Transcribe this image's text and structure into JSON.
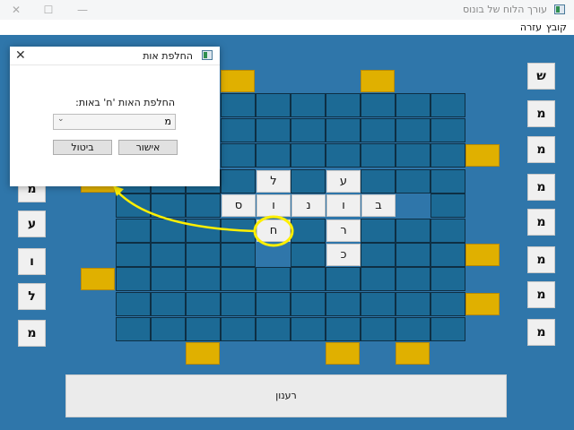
{
  "window": {
    "title": "עורך הלוח של בונוס",
    "minimize": "—",
    "maximize": "☐",
    "close": "✕"
  },
  "menu": [
    "קובץ",
    "עזרה"
  ],
  "board": {
    "empty_cells": [
      [
        104,
        3
      ],
      [
        104,
        4
      ],
      [
        104,
        5
      ],
      [
        104,
        6
      ],
      [
        104,
        7
      ],
      [
        104,
        8
      ],
      [
        104,
        9
      ],
      [
        132,
        3
      ],
      [
        132,
        4
      ],
      [
        132,
        5
      ],
      [
        132,
        6
      ],
      [
        132,
        7
      ],
      [
        132,
        8
      ],
      [
        132,
        9
      ],
      [
        160,
        3
      ],
      [
        160,
        4
      ],
      [
        160,
        5
      ],
      [
        160,
        6
      ],
      [
        160,
        7
      ],
      [
        160,
        8
      ],
      [
        160,
        9
      ],
      [
        189,
        0
      ],
      [
        189,
        1
      ],
      [
        189,
        2
      ],
      [
        189,
        3
      ],
      [
        189,
        5
      ],
      [
        189,
        7
      ],
      [
        189,
        8
      ],
      [
        189,
        9
      ],
      [
        216,
        0
      ],
      [
        216,
        1
      ],
      [
        216,
        2
      ],
      [
        216,
        9
      ],
      [
        244,
        0
      ],
      [
        244,
        1
      ],
      [
        244,
        2
      ],
      [
        244,
        3
      ],
      [
        244,
        5
      ],
      [
        244,
        7
      ],
      [
        244,
        8
      ],
      [
        244,
        9
      ],
      [
        271,
        0
      ],
      [
        271,
        1
      ],
      [
        271,
        2
      ],
      [
        271,
        3
      ],
      [
        271,
        5
      ],
      [
        271,
        7
      ],
      [
        271,
        8
      ],
      [
        271,
        9
      ],
      [
        298,
        0
      ],
      [
        298,
        1
      ],
      [
        298,
        2
      ],
      [
        298,
        3
      ],
      [
        298,
        4
      ],
      [
        298,
        5
      ],
      [
        298,
        6
      ],
      [
        298,
        7
      ],
      [
        298,
        8
      ],
      [
        298,
        9
      ],
      [
        326,
        0
      ],
      [
        326,
        1
      ],
      [
        326,
        2
      ],
      [
        326,
        3
      ],
      [
        326,
        4
      ],
      [
        326,
        5
      ],
      [
        326,
        6
      ],
      [
        326,
        7
      ],
      [
        326,
        8
      ],
      [
        326,
        9
      ],
      [
        354,
        0
      ],
      [
        354,
        1
      ],
      [
        354,
        2
      ],
      [
        354,
        3
      ],
      [
        354,
        4
      ],
      [
        354,
        5
      ],
      [
        354,
        6
      ],
      [
        354,
        7
      ],
      [
        354,
        8
      ],
      [
        354,
        9
      ]
    ],
    "letters": [
      {
        "col": 4,
        "row": 189,
        "text": "ל"
      },
      {
        "col": 6,
        "row": 189,
        "text": "ע"
      },
      {
        "col": 3,
        "row": 216,
        "text": "ס"
      },
      {
        "col": 4,
        "row": 216,
        "text": "ו"
      },
      {
        "col": 5,
        "row": 216,
        "text": "נ"
      },
      {
        "col": 6,
        "row": 216,
        "text": "ו"
      },
      {
        "col": 7,
        "row": 216,
        "text": "ב"
      },
      {
        "col": 4,
        "row": 244,
        "text": "ח"
      },
      {
        "col": 6,
        "row": 244,
        "text": "ר"
      },
      {
        "col": 6,
        "row": 271,
        "text": "כ"
      }
    ]
  },
  "side_letters_left": [
    "מ",
    "ע",
    "ו",
    "ל",
    "מ"
  ],
  "side_letters_right": [
    "ש",
    "מ",
    "מ",
    "מ",
    "מ",
    "מ",
    "מ",
    "מ"
  ],
  "refresh_button": "רענון",
  "dialog": {
    "title": "החלפת אות",
    "close": "✕",
    "prompt": "החלפת האות 'ח' באות:",
    "select_value": "מ",
    "confirm": "אישור",
    "cancel": "ביטול"
  },
  "colors": {
    "background": "#2f76aa",
    "cell": "#1c6a95",
    "bonus": "#e0b000",
    "highlight": "#ffef00"
  }
}
